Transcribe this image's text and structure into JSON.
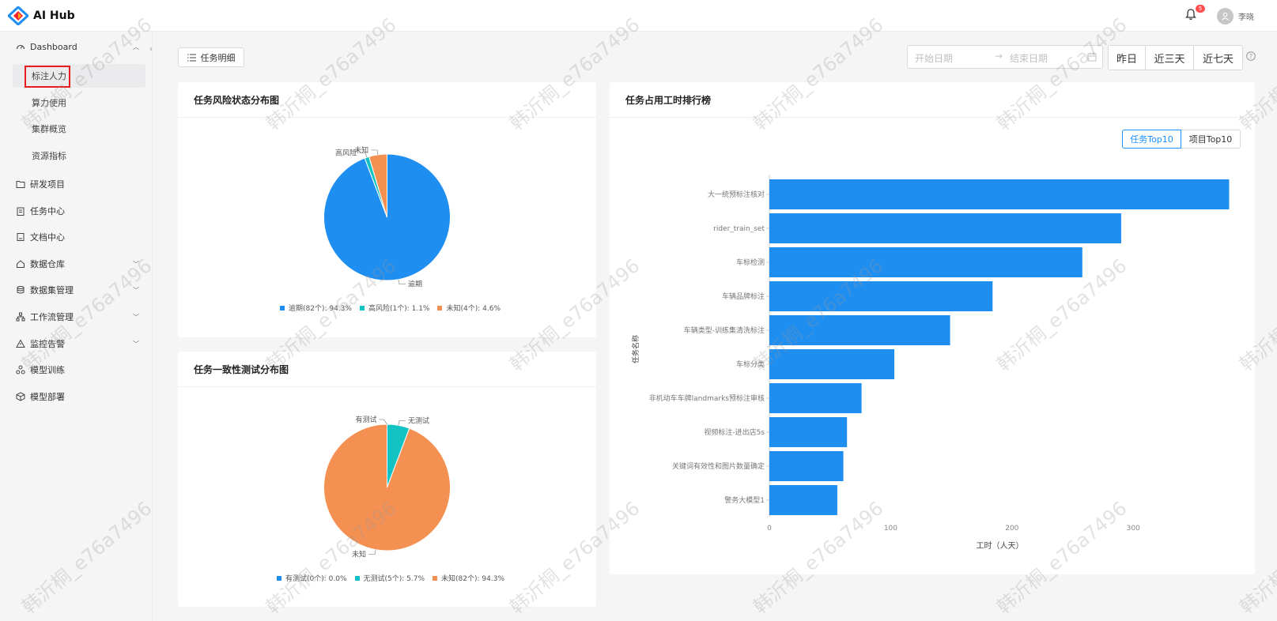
{
  "app": {
    "name": "AI Hub"
  },
  "header": {
    "notification_count": "5",
    "user_name": "李晓"
  },
  "sidebar": {
    "dashboard": {
      "label": "Dashboard",
      "icon": "dashboard-icon"
    },
    "dashboard_children": [
      {
        "label": "标注人力",
        "active": true
      },
      {
        "label": "算力使用"
      },
      {
        "label": "集群概览"
      },
      {
        "label": "资源指标"
      }
    ],
    "items": [
      {
        "label": "研发项目",
        "icon": "folder-icon",
        "has_children": false
      },
      {
        "label": "任务中心",
        "icon": "clipboard-icon",
        "has_children": false
      },
      {
        "label": "文档中心",
        "icon": "document-icon",
        "has_children": false
      },
      {
        "label": "数据仓库",
        "icon": "home-icon",
        "has_children": true
      },
      {
        "label": "数据集管理",
        "icon": "database-icon",
        "has_children": true
      },
      {
        "label": "工作流管理",
        "icon": "workflow-icon",
        "has_children": true
      },
      {
        "label": "监控告警",
        "icon": "warning-icon",
        "has_children": true
      },
      {
        "label": "模型训练",
        "icon": "training-icon",
        "has_children": false
      },
      {
        "label": "模型部署",
        "icon": "cube-icon",
        "has_children": false
      }
    ]
  },
  "toolbar": {
    "detail_button": "任务明细",
    "date_start_placeholder": "开始日期",
    "date_end_placeholder": "结束日期",
    "quick_ranges": [
      "昨日",
      "近三天",
      "近七天"
    ]
  },
  "watermark": "韩沂桐_e76a7496",
  "chart_data": [
    {
      "type": "pie",
      "title": "任务风险状态分布图",
      "slices": [
        {
          "name": "逾期",
          "count": 82,
          "percent": 94.3,
          "color": "#1f8ef1",
          "legend": "逾期(82个): 94.3%"
        },
        {
          "name": "高风险",
          "count": 1,
          "percent": 1.1,
          "color": "#13c2c2",
          "legend": "高风险(1个): 1.1%"
        },
        {
          "name": "未知",
          "count": 4,
          "percent": 4.6,
          "color": "#f59053",
          "legend": "未知(4个): 4.6%"
        }
      ]
    },
    {
      "type": "pie",
      "title": "任务一致性测试分布图",
      "slices": [
        {
          "name": "有测试",
          "count": 0,
          "percent": 0.0,
          "color": "#1f8ef1",
          "legend": "有测试(0个): 0.0%"
        },
        {
          "name": "无测试",
          "count": 5,
          "percent": 5.7,
          "color": "#13c2c2",
          "legend": "无测试(5个): 5.7%"
        },
        {
          "name": "未知",
          "count": 82,
          "percent": 94.3,
          "color": "#f59053",
          "legend": "未知(82个): 94.3%"
        }
      ]
    },
    {
      "type": "bar",
      "orientation": "horizontal",
      "title": "任务占用工时排行榜",
      "toggle": [
        "任务Top10",
        "项目Top10"
      ],
      "toggle_selected": "任务Top10",
      "ylabel": "任务名称",
      "xlabel": "工时（人天）",
      "xlim": [
        0,
        380
      ],
      "xticks": [
        0,
        100,
        200,
        300
      ],
      "color": "#1f8ef1",
      "categories": [
        "大一统预标注核对",
        "rider_train_set",
        "车标检测",
        "车辆品牌标注",
        "车辆类型-训练集清洗标注",
        "车标分类",
        "非机动车车牌landmarks预标注审核",
        "视频标注-进出店5s",
        "关键词有效性和图片数量确定",
        "警务大模型1"
      ],
      "values": [
        379,
        290,
        258,
        184,
        149,
        103,
        76,
        64,
        61,
        56
      ]
    }
  ]
}
